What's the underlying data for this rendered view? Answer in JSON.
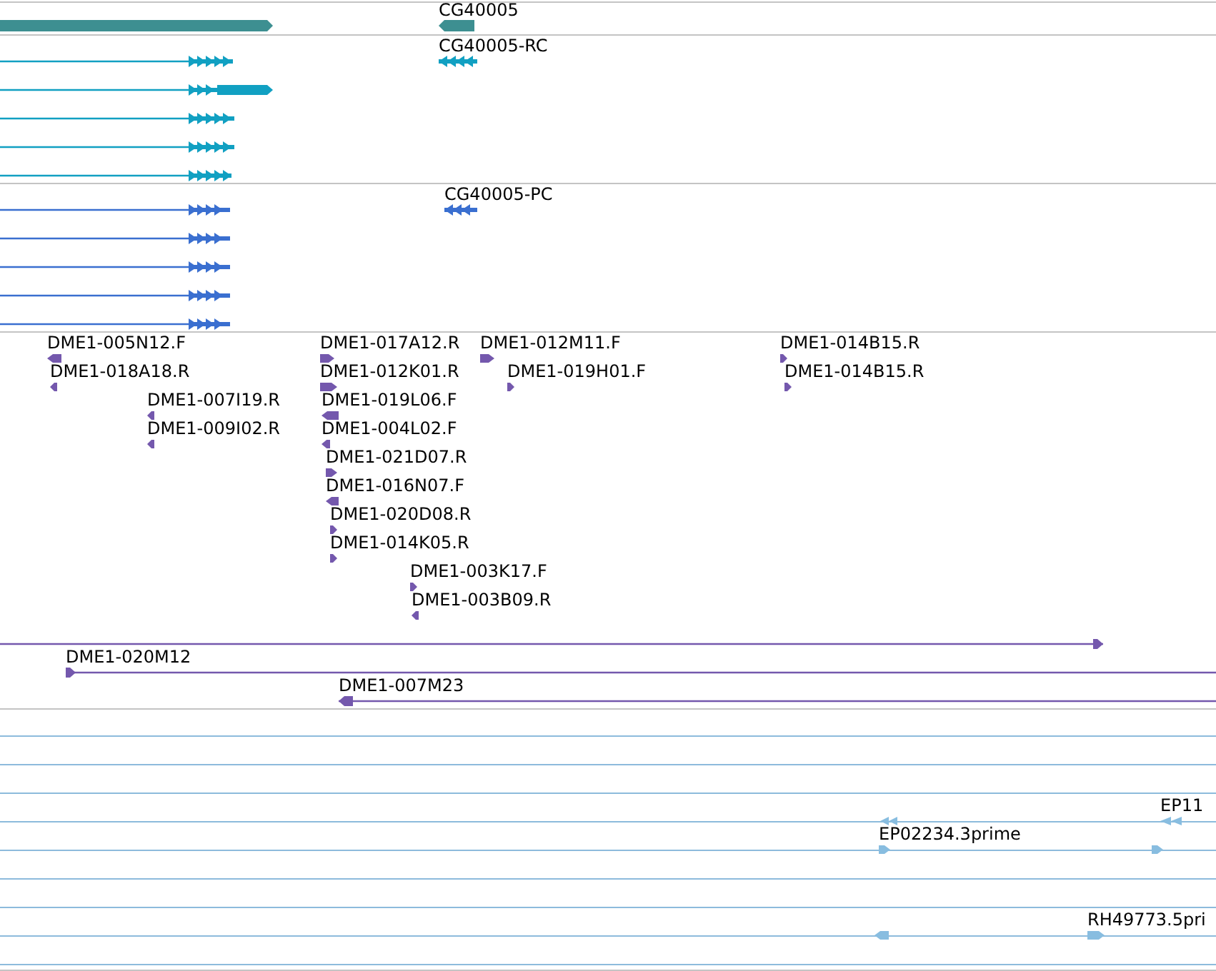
{
  "tracks": [
    {
      "color": "#3d8f91",
      "features": [
        {
          "kind": "block",
          "reverse": false
        },
        {
          "kind": "block",
          "reverse": true,
          "label": "CG40005"
        }
      ]
    },
    {
      "color": "#11a0c2",
      "features": [
        {
          "kind": "transcript",
          "reverse": false
        },
        {
          "kind": "transcript",
          "reverse": false
        },
        {
          "kind": "transcript",
          "reverse": false
        },
        {
          "kind": "transcript",
          "reverse": false
        },
        {
          "kind": "transcript",
          "reverse": false
        },
        {
          "kind": "transcript",
          "reverse": true,
          "label": "CG40005-RC"
        }
      ]
    },
    {
      "color": "#3a6fd0",
      "features": [
        {
          "kind": "transcript",
          "reverse": false
        },
        {
          "kind": "transcript",
          "reverse": false
        },
        {
          "kind": "transcript",
          "reverse": false
        },
        {
          "kind": "transcript",
          "reverse": false
        },
        {
          "kind": "transcript",
          "reverse": false
        },
        {
          "kind": "transcript",
          "reverse": true,
          "label": "CG40005-PC"
        }
      ]
    },
    {
      "color": "#7458ad",
      "features": [
        {
          "kind": "read",
          "reverse": true,
          "label": "DME1-005N12.F"
        },
        {
          "kind": "read",
          "reverse": true,
          "label": "DME1-018A18.R"
        },
        {
          "kind": "read",
          "reverse": true,
          "label": "DME1-007I19.R"
        },
        {
          "kind": "read",
          "reverse": true,
          "label": "DME1-009I02.R"
        },
        {
          "kind": "read",
          "reverse": false,
          "label": "DME1-017A12.R"
        },
        {
          "kind": "read",
          "reverse": false,
          "label": "DME1-012K01.R"
        },
        {
          "kind": "read",
          "reverse": true,
          "label": "DME1-019L06.F"
        },
        {
          "kind": "read",
          "reverse": true,
          "label": "DME1-004L02.F"
        },
        {
          "kind": "read",
          "reverse": false,
          "label": "DME1-021D07.R"
        },
        {
          "kind": "read",
          "reverse": true,
          "label": "DME1-016N07.F"
        },
        {
          "kind": "read",
          "reverse": false,
          "label": "DME1-020D08.R"
        },
        {
          "kind": "read",
          "reverse": false,
          "label": "DME1-014K05.R"
        },
        {
          "kind": "read",
          "reverse": false,
          "label": "DME1-003K17.F"
        },
        {
          "kind": "read",
          "reverse": true,
          "label": "DME1-003B09.R"
        },
        {
          "kind": "read",
          "reverse": false,
          "label": "DME1-012M11.F"
        },
        {
          "kind": "read",
          "reverse": false,
          "label": "DME1-019H01.F"
        },
        {
          "kind": "read",
          "reverse": false,
          "label": "DME1-014B15.R"
        },
        {
          "kind": "read",
          "reverse": false,
          "label": "DME1-014B15.R"
        },
        {
          "kind": "pair",
          "reverse": false
        },
        {
          "kind": "pair",
          "reverse": false,
          "label": "DME1-020M12"
        },
        {
          "kind": "pair",
          "reverse": true,
          "label": "DME1-007M23"
        }
      ]
    },
    {
      "color": "#88bde0",
      "features": [
        {
          "kind": "read",
          "reverse": true
        },
        {
          "kind": "read",
          "reverse": true,
          "label": "EP11"
        },
        {
          "kind": "read",
          "reverse": false,
          "label": "EP02234.3prime"
        },
        {
          "kind": "read",
          "reverse": false
        },
        {
          "kind": "read",
          "reverse": true
        },
        {
          "kind": "read",
          "reverse": false,
          "label": "RH49773.5pri"
        }
      ]
    }
  ]
}
